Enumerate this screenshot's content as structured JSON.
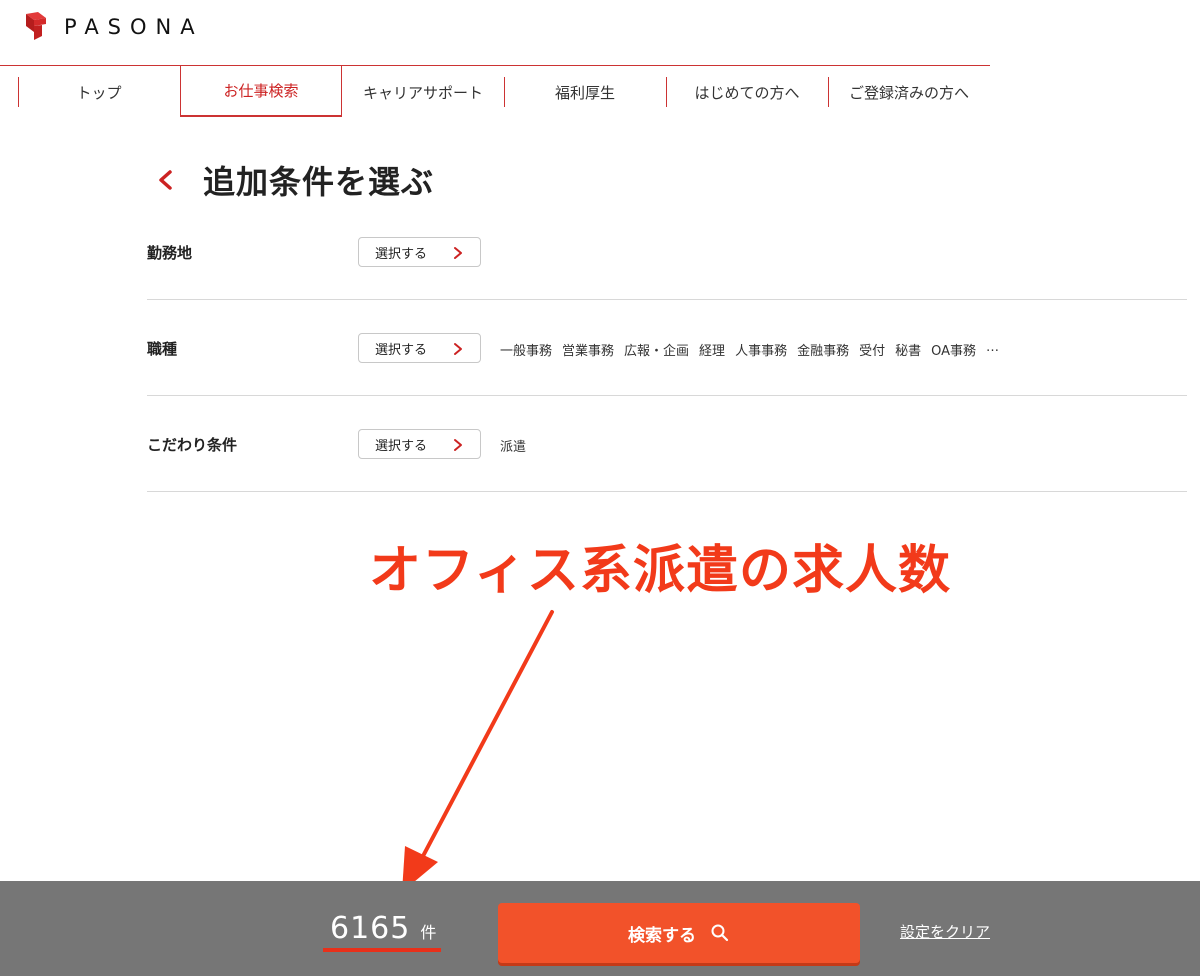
{
  "header": {
    "logo_text": "PASONA",
    "brand_color": "#cc2222"
  },
  "nav": {
    "items": [
      {
        "label": "トップ",
        "active": false
      },
      {
        "label": "お仕事検索",
        "active": true
      },
      {
        "label": "キャリアサポート",
        "active": false
      },
      {
        "label": "福利厚生",
        "active": false
      },
      {
        "label": "はじめての方へ",
        "active": false
      },
      {
        "label": "ご登録済みの方へ",
        "active": false
      }
    ]
  },
  "page": {
    "title": "追加条件を選ぶ",
    "back_icon": "chevron-left-icon"
  },
  "conditions": [
    {
      "label": "勤務地",
      "button_label": "選択する",
      "tags": []
    },
    {
      "label": "職種",
      "button_label": "選択する",
      "tags": [
        "一般事務",
        "営業事務",
        "広報・企画",
        "経理",
        "人事事務",
        "金融事務",
        "受付",
        "秘書",
        "OA事務",
        "…"
      ]
    },
    {
      "label": "こだわり条件",
      "button_label": "選択する",
      "tags": [
        "派遣"
      ]
    }
  ],
  "annotation": {
    "text": "オフィス系派遣の求人数",
    "color": "#f23a1a"
  },
  "footer": {
    "count": "6165",
    "count_unit": "件",
    "search_label": "検索する",
    "search_icon": "search-icon",
    "clear_label": "設定をクリア",
    "button_color": "#f2522a",
    "bar_color": "#767676"
  }
}
